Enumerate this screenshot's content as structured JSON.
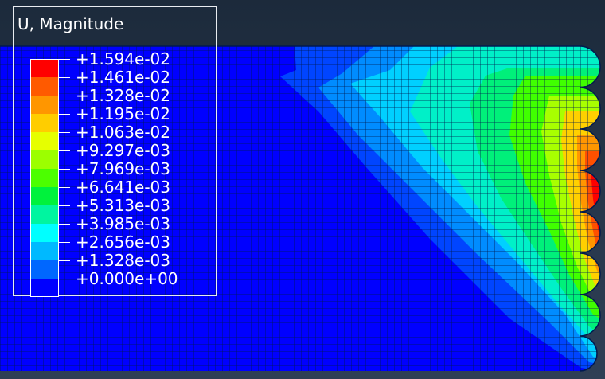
{
  "legend": {
    "title": "U, Magnitude",
    "labels": [
      "+1.594e-02",
      "+1.461e-02",
      "+1.328e-02",
      "+1.195e-02",
      "+1.063e-02",
      "+9.297e-03",
      "+7.969e-03",
      "+6.641e-03",
      "+5.313e-03",
      "+3.985e-03",
      "+2.656e-03",
      "+1.328e-03",
      "+0.000e+00"
    ],
    "colors": [
      "#ff0000",
      "#ff5a00",
      "#ff9600",
      "#ffcd00",
      "#e6ff00",
      "#9cff00",
      "#4cff00",
      "#00f23c",
      "#00f5a0",
      "#00ffff",
      "#00b9ff",
      "#0067ff",
      "#0000ff"
    ]
  },
  "theme": {
    "background_top": "#1c2a3b",
    "background_bottom": "#2f3f55",
    "mesh_line": "#001a50",
    "legend_text": "#ffffff"
  }
}
